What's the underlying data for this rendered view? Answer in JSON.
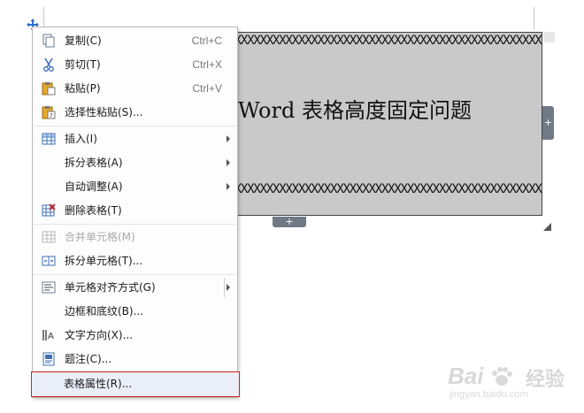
{
  "document": {
    "table_title": "Word 表格高度固定问题",
    "x_line": "XXXXXXXXXXXXXXXXXXXXXXXXXXXXXXXXXXXXXXXXXXXXXXXXXXXX",
    "add_column_symbol": "+",
    "add_row_symbol": "+"
  },
  "context_menu": {
    "items": [
      {
        "label": "复制(C)",
        "shortcut": "Ctrl+C",
        "icon": "copy-icon"
      },
      {
        "label": "剪切(T)",
        "shortcut": "Ctrl+X",
        "icon": "scissors-icon"
      },
      {
        "label": "粘贴(P)",
        "shortcut": "Ctrl+V",
        "icon": "paste-icon"
      },
      {
        "label": "选择性粘贴(S)...",
        "shortcut": "",
        "icon": "paste-special-icon"
      },
      {
        "label": "插入(I)",
        "icon": "insert-table-icon",
        "submenu": true
      },
      {
        "label": "拆分表格(A)",
        "submenu": true
      },
      {
        "label": "自动调整(A)",
        "submenu": true
      },
      {
        "label": "删除表格(T)",
        "icon": "delete-table-icon"
      },
      {
        "label": "合并单元格(M)",
        "icon": "merge-cells-icon",
        "disabled": true
      },
      {
        "label": "拆分单元格(T)...",
        "icon": "split-cells-icon"
      },
      {
        "label": "单元格对齐方式(G)",
        "icon": "cell-align-icon",
        "submenu": true
      },
      {
        "label": "边框和底纹(B)..."
      },
      {
        "label": "文字方向(X)...",
        "icon": "text-direction-icon"
      },
      {
        "label": "题注(C)...",
        "icon": "caption-icon"
      },
      {
        "label": "表格属性(R)...",
        "highlighted": true
      }
    ]
  },
  "watermark": {
    "brand": "Bai",
    "brand_suffix": "经验",
    "url": "jingyan.baidu.com"
  },
  "colors": {
    "table_fill": "#c9c9c9",
    "highlight_border": "#d21f1f",
    "highlight_fill": "#e9eef8",
    "handle": "#6f7a86"
  }
}
